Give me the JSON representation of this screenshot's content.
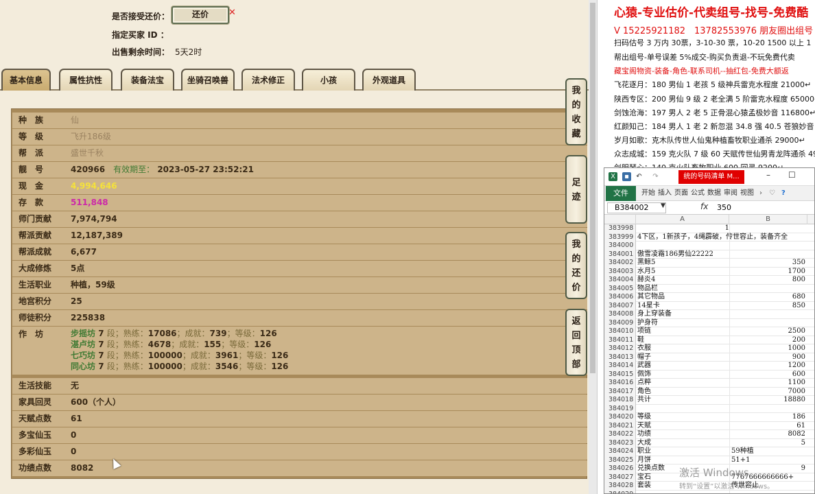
{
  "game": {
    "accept_counter_label": "是否接受还价：",
    "counter_button": "还价",
    "buyer_id_label": "指定买家 ID ：",
    "time_left_label": "出售剩余时间：",
    "time_left_value": "5天2时",
    "tabs": [
      "基本信息",
      "属性抗性",
      "装备法宝",
      "坐骑召唤兽",
      "法术修正",
      "小孩",
      "外观道具"
    ],
    "rows": [
      {
        "k": "种　族",
        "v": "仙",
        "cls": "pale"
      },
      {
        "k": "等　级",
        "v": "飞升186级",
        "cls": "pale"
      },
      {
        "k": "帮　派",
        "v": "盛世千秋",
        "cls": "pale"
      },
      {
        "k": "靓　号",
        "v": "420966",
        "extra_label": "有效期至：",
        "extra_value": "2023-05-27 23:52:21"
      },
      {
        "k": "现　金",
        "v": "4,994,646",
        "cls": "yellow"
      },
      {
        "k": "存　款",
        "v": "511,848",
        "cls": "magenta"
      },
      {
        "k": "师门贡献",
        "v": "7,974,794"
      },
      {
        "k": "帮派贡献",
        "v": "12,187,389"
      },
      {
        "k": "帮派成就",
        "v": "6,677"
      },
      {
        "k": "大成修炼",
        "v": "5点"
      },
      {
        "k": "生活职业",
        "v": "种植，59级"
      },
      {
        "k": "地宫积分",
        "v": "25"
      },
      {
        "k": "师徒积分",
        "v": "225838"
      }
    ],
    "workshop_label": "作　坊",
    "workshops": [
      {
        "name": "步摇坊",
        "dan": "7",
        "shulian": "17086",
        "chengjiu": "739",
        "dengji": "126"
      },
      {
        "name": "湛卢坊",
        "dan": "7",
        "shulian": "4678",
        "chengjiu": "155",
        "dengji": "126"
      },
      {
        "name": "七巧坊",
        "dan": "7",
        "shulian": "100000",
        "chengjiu": "3961",
        "dengji": "126"
      },
      {
        "name": "同心坊",
        "dan": "7",
        "shulian": "100000",
        "chengjiu": "3546",
        "dengji": "126"
      }
    ],
    "workshop_words": {
      "duan": "段；",
      "shulian": "熟练：",
      "chengjiu": "；成就：",
      "dengji": "；等级："
    },
    "rows_after": [
      {
        "k": "生活技能",
        "v": "无"
      },
      {
        "k": "家具回灵",
        "v": "600（个人）"
      },
      {
        "k": "天赋点数",
        "v": "61"
      },
      {
        "k": "多宝仙玉",
        "v": "0"
      },
      {
        "k": "多彩仙玉",
        "v": "0"
      },
      {
        "k": "功绩点数",
        "v": "8082"
      }
    ],
    "side_buttons": [
      {
        "name": "my-favorites",
        "chars": [
          "我",
          "的",
          "收",
          "藏"
        ]
      },
      {
        "name": "footprint",
        "chars": [
          "足",
          "迹"
        ]
      },
      {
        "name": "my-counter",
        "chars": [
          "我",
          "的",
          "还",
          "价"
        ]
      },
      {
        "name": "back-to-top",
        "chars": [
          "返",
          "回",
          "顶",
          "部"
        ]
      }
    ]
  },
  "ad": {
    "title": "心猿-专业估价-代卖组号-找号-免费酷",
    "phones": "V 15225921182　13782553976 朋友圈出组号",
    "lines": [
      {
        "t": "扫码估号 3 万内 30票，3-10-30 票，10-20 1500 以上 1",
        "red": false
      },
      {
        "t": "帮出组号-单号误差 5%成交-购买负责退-不玩免费代卖",
        "red": false
      },
      {
        "t": "藏宝阁物资-装备-角色-联系司机--抽红包-免费大额返",
        "red": true
      },
      {
        "t": "飞花逐月：180 男仙 1 老孩 5 级神兵雷克水程度 21000↵",
        "red": false
      },
      {
        "t": "陕西专区：200 男仙 9 级 2 老全满 5 阶雷克水程度 65000↵",
        "red": false
      },
      {
        "t": "剑蚀沧海：197 男人 2 老 5 正骨混心猿孟极妙音 116800↵",
        "red": false
      },
      {
        "t": "红颜知己：184 男人 1 老 2 新忽混 34.8 强 40.5 苍狼妙音 22",
        "red": false
      },
      {
        "t": "岁月如歌：克木队传世人仙鬼种植畜牧职业通杀 29000↵",
        "red": false
      },
      {
        "t": "众志成城：159 克火队 7 级 60 天赋传世仙男青龙阵通杀 49",
        "red": false
      },
      {
        "t": "剑胆琴心：140 克火队畜牧职业 600 回灵 9200↵",
        "red": false
      }
    ]
  },
  "excel": {
    "window_title": "统的号码清单 M...",
    "ribbon_tabs": [
      "文件",
      "开始",
      "插入",
      "页面",
      "公式",
      "数据",
      "审阅",
      "视图"
    ],
    "name_box": "B384002",
    "fx": "fx",
    "formula_value": "350",
    "col_a": "A",
    "col_b": "B",
    "rows": [
      {
        "n": "383998",
        "a": "1",
        "ar": true,
        "b": ""
      },
      {
        "n": "383999",
        "a": "4下区，1新孩子，4绳霹破，传世容止，装备齐全",
        "b": ""
      },
      {
        "n": "384000",
        "a": "",
        "b": ""
      },
      {
        "n": "384001",
        "a": "傲雪凌霜186男仙22222",
        "b": ""
      },
      {
        "n": "384002",
        "a": "黑鲸5",
        "b": "350",
        "br": true
      },
      {
        "n": "384003",
        "a": "水月5",
        "b": "1700",
        "br": true
      },
      {
        "n": "384004",
        "a": "赫炎4",
        "b": "800",
        "br": true
      },
      {
        "n": "384005",
        "a": "物品栏",
        "b": ""
      },
      {
        "n": "384006",
        "a": "其它物品",
        "b": "680",
        "br": true
      },
      {
        "n": "384007",
        "a": "14星卡",
        "b": "850",
        "br": true
      },
      {
        "n": "384008",
        "a": "身上穿装备",
        "b": ""
      },
      {
        "n": "384009",
        "a": "护身符",
        "b": ""
      },
      {
        "n": "384010",
        "a": "项链",
        "b": "2500",
        "br": true
      },
      {
        "n": "384011",
        "a": "鞋",
        "b": "200",
        "br": true
      },
      {
        "n": "384012",
        "a": "衣服",
        "b": "1000",
        "br": true
      },
      {
        "n": "384013",
        "a": "帽子",
        "b": "900",
        "br": true
      },
      {
        "n": "384014",
        "a": "武器",
        "b": "1200",
        "br": true
      },
      {
        "n": "384015",
        "a": "佩饰",
        "b": "600",
        "br": true
      },
      {
        "n": "384016",
        "a": "点粹",
        "b": "1100",
        "br": true
      },
      {
        "n": "384017",
        "a": "角色",
        "b": "7000",
        "br": true
      },
      {
        "n": "384018",
        "a": "共计",
        "b": "18880",
        "br": true
      },
      {
        "n": "384019",
        "a": "",
        "b": ""
      },
      {
        "n": "384020",
        "a": "等级",
        "b": "186",
        "br": true
      },
      {
        "n": "384021",
        "a": "天赋",
        "b": "61",
        "br": true
      },
      {
        "n": "384022",
        "a": "功绩",
        "b": "8082",
        "br": true
      },
      {
        "n": "384023",
        "a": "大成",
        "b": "5",
        "br": true
      },
      {
        "n": "384024",
        "a": "职业",
        "b": "59种植"
      },
      {
        "n": "384025",
        "a": "月饼",
        "b": "51+1"
      },
      {
        "n": "384026",
        "a": "兑换点数",
        "b": "9",
        "br": true
      },
      {
        "n": "384027",
        "a": "宝石",
        "b": "7767666666666+"
      },
      {
        "n": "384028",
        "a": "套装",
        "b": "传世容止"
      },
      {
        "n": "384029",
        "a": "",
        "b": ""
      }
    ]
  },
  "watermark": {
    "line1": "激活 Windows",
    "line2": "转到“设置”以激活 Windows。"
  }
}
